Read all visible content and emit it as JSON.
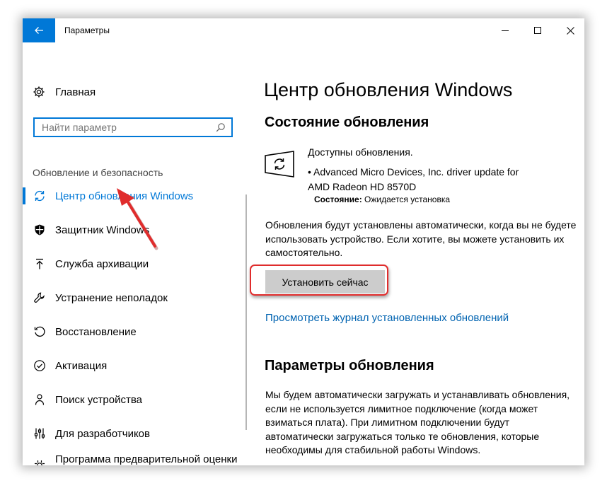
{
  "window": {
    "title": "Параметры",
    "back_icon": "back-arrow-icon",
    "controls": [
      "minimize-icon",
      "maximize-icon",
      "close-icon"
    ]
  },
  "sidebar": {
    "home_label": "Главная",
    "search_placeholder": "Найти параметр",
    "section_label": "Обновление и безопасность",
    "items": [
      {
        "label": "Центр обновления Windows",
        "icon": "refresh-icon",
        "active": true
      },
      {
        "label": "Защитник Windows",
        "icon": "shield-icon"
      },
      {
        "label": "Служба архивации",
        "icon": "backup-arrow-icon"
      },
      {
        "label": "Устранение неполадок",
        "icon": "wrench-icon"
      },
      {
        "label": "Восстановление",
        "icon": "recovery-icon"
      },
      {
        "label": "Активация",
        "icon": "check-circle-icon"
      },
      {
        "label": "Поиск устройства",
        "icon": "person-pin-icon"
      },
      {
        "label": "Для разработчиков",
        "icon": "developer-sliders-icon"
      },
      {
        "label": "Программа предварительной оценки Windows",
        "icon": "insider-icon"
      }
    ]
  },
  "main": {
    "title": "Центр обновления Windows",
    "status_heading": "Состояние обновления",
    "updates_available": "Доступны обновления.",
    "update_item_line1": "• Advanced Micro Devices, Inc. driver update for",
    "update_item_line2": "AMD Radeon HD 8570D",
    "status_label": "Состояние:",
    "status_value": "Ожидается установка",
    "auto_install_text": "Обновления будут установлены автоматически, когда вы не будете использовать устройство. Если хотите, вы можете установить их самостоятельно.",
    "install_button": "Установить сейчас",
    "history_link": "Просмотреть журнал установленных обновлений",
    "settings_heading": "Параметры обновления",
    "settings_text": "Мы будем автоматически загружать и устанавливать обновления, если не используется лимитное подключение (когда может взиматься плата). При лимитном подключении будут автоматически загружаться только те обновления, которые необходимы для стабильной работы Windows."
  },
  "colors": {
    "accent": "#0078d7",
    "link": "#0063b1",
    "highlight_red": "#e02c2c",
    "button_gray": "#cccccc"
  }
}
